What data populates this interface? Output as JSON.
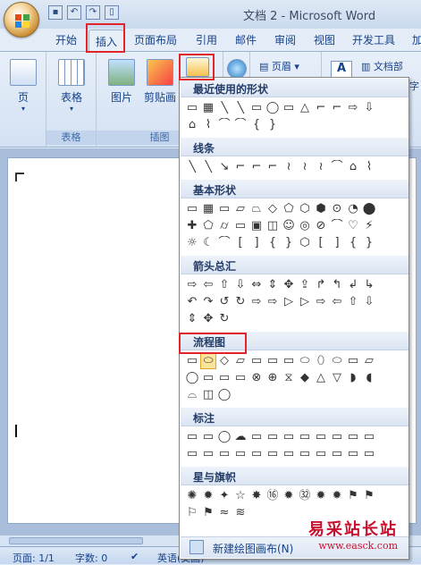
{
  "window": {
    "title": "文档 2 - Microsoft Word"
  },
  "quick_access": {
    "items": [
      "save-icon",
      "undo-icon",
      "redo-icon",
      "new-doc-icon"
    ]
  },
  "tabs": [
    {
      "label": "开始"
    },
    {
      "label": "插入",
      "active": true
    },
    {
      "label": "页面布局"
    },
    {
      "label": "引用"
    },
    {
      "label": "邮件"
    },
    {
      "label": "审阅"
    },
    {
      "label": "视图"
    },
    {
      "label": "开发工具"
    },
    {
      "label": "加"
    }
  ],
  "ribbon": {
    "groups": {
      "pages": {
        "button": "页",
        "label": ""
      },
      "tables": {
        "button": "表格",
        "label": "表格"
      },
      "illustrations": {
        "picture": "图片",
        "clipart": "剪贴画",
        "label": "插图"
      },
      "header_footer": {
        "header": "页眉"
      },
      "text": {
        "wordart": "A",
        "docparts": "文档部",
        "extra": "字"
      }
    }
  },
  "shapes_menu": {
    "sections": [
      {
        "title": "最近使用的形状",
        "rows": [
          [
            "▭",
            "▦",
            "╲",
            "╲",
            "▭",
            "◯",
            "▭",
            "△",
            "⌐",
            "⌐",
            "⇨",
            "⇩"
          ],
          [
            "⌂",
            "⌇",
            "⌒",
            "⌒",
            "{",
            "}"
          ]
        ]
      },
      {
        "title": "线条",
        "rows": [
          [
            "╲",
            "╲",
            "↘",
            "⌐",
            "⌐",
            "⌐",
            "≀",
            "≀",
            "≀",
            "⌒",
            "⌂",
            "⌇"
          ]
        ]
      },
      {
        "title": "基本形状",
        "rows": [
          [
            "▭",
            "▦",
            "▭",
            "▱",
            "⏢",
            "◇",
            "⬠",
            "⬡",
            "⬢",
            "⊙",
            "◔",
            "⬤"
          ],
          [
            "✚",
            "⬠",
            "⌭",
            "▭",
            "▣",
            "◫",
            "☺",
            "◎",
            "⊘",
            "⌒",
            "♡",
            "⚡"
          ],
          [
            "☼",
            "☾",
            "⌒",
            "[",
            "]",
            "{",
            "}",
            "⬡",
            "[",
            "]",
            "{",
            "}"
          ]
        ]
      },
      {
        "title": "箭头总汇",
        "rows": [
          [
            "⇨",
            "⇦",
            "⇧",
            "⇩",
            "⇔",
            "⇕",
            "✥",
            "⇪",
            "↱",
            "↰",
            "↲",
            "↳"
          ],
          [
            "↶",
            "↷",
            "↺",
            "↻",
            "⇨",
            "⇨",
            "▷",
            "▷",
            "⇨",
            "⇦",
            "⇧",
            "⇩"
          ],
          [
            "⇕",
            "✥",
            "↻"
          ]
        ]
      },
      {
        "title": "流程图",
        "rows": [
          [
            "▭",
            "⬭",
            "◇",
            "▱",
            "▭",
            "▭",
            "▭",
            "⬭",
            "⬯",
            "⬭",
            "▭",
            "▱"
          ],
          [
            "◯",
            "▭",
            "▭",
            "▭",
            "⊗",
            "⊕",
            "⧖",
            "◆",
            "△",
            "▽",
            "◗",
            "◖"
          ],
          [
            "⌓",
            "◫",
            "◯"
          ]
        ]
      },
      {
        "title": "标注",
        "rows": [
          [
            "▭",
            "▭",
            "◯",
            "☁",
            "▭",
            "▭",
            "▭",
            "▭",
            "▭",
            "▭",
            "▭",
            "▭"
          ],
          [
            "▭",
            "▭",
            "▭",
            "▭",
            "▭",
            "▭",
            "▭",
            "▭",
            "▭",
            "▭",
            "▭",
            "▭"
          ]
        ]
      },
      {
        "title": "星与旗帜",
        "rows": [
          [
            "✺",
            "✹",
            "✦",
            "☆",
            "✸",
            "⑯",
            "✹",
            "㉜",
            "✹",
            "✹",
            "⚑",
            "⚑"
          ],
          [
            "⚐",
            "⚑",
            "≈",
            "≋"
          ]
        ]
      }
    ],
    "selected_shape": {
      "section": 4,
      "row": 0,
      "col": 1
    },
    "new_canvas_label": "新建绘图画布(N)"
  },
  "statusbar": {
    "page": "页面: 1/1",
    "words": "字数: 0",
    "language": "英语(美国)"
  },
  "watermark": {
    "title": "易采站长站",
    "url": "www.easck.com"
  }
}
